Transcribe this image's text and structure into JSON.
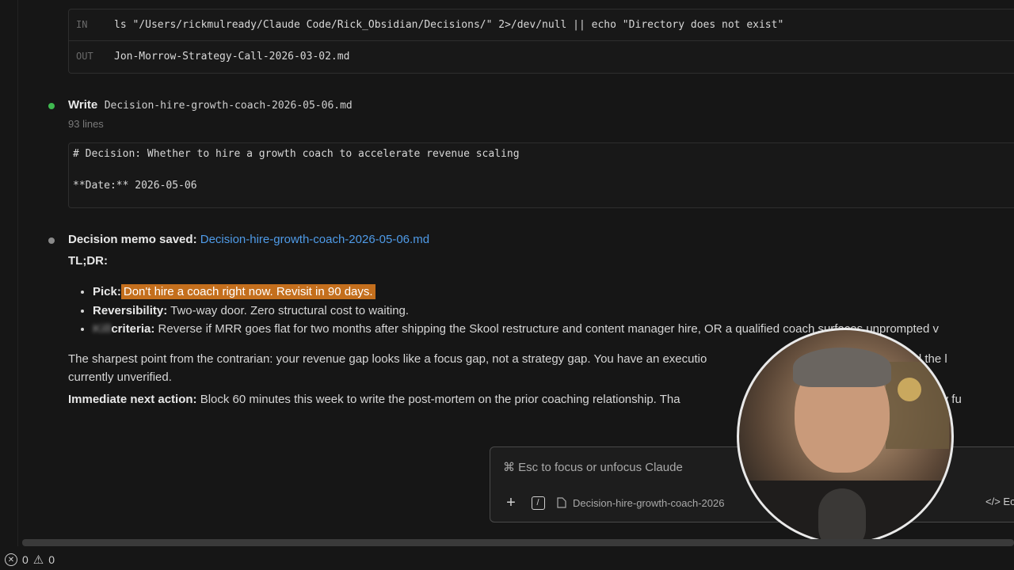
{
  "tool_block_1": {
    "in_tag": "IN",
    "in_text": "ls \"/Users/rickmulready/Claude Code/Rick_Obsidian/Decisions/\" 2>/dev/null || echo \"Directory does not exist\"",
    "out_tag": "OUT",
    "out_text": "Jon-Morrow-Strategy-Call-2026-03-02.md"
  },
  "write_step": {
    "action": "Write",
    "filename": "Decision-hire-growth-coach-2026-05-06.md",
    "line_count": "93 lines",
    "preview_line1": "# Decision: Whether to hire a growth coach to accelerate revenue scaling",
    "preview_line2": "**Date:** 2026-05-06"
  },
  "memo": {
    "saved_label": "Decision memo saved:",
    "saved_link": "Decision-hire-growth-coach-2026-05-06.md",
    "tldr": "TL;DR:",
    "bullets": [
      {
        "label": "Pick:",
        "text": "Don't hire a coach right now. Revisit in 90 days."
      },
      {
        "label": "Reversibility:",
        "text": " Two-way door. Zero structural cost to waiting."
      },
      {
        "label_blur": "Kill",
        "label": "criteria:",
        "text": " Reverse if MRR goes flat for two months after shipping the Skool restructure and content manager hire, OR a qualified coach surfaces unprompted v"
      }
    ],
    "para1_line1": "The sharpest point from the contrarian: your revenue gap looks like a focus gap, not a strategy gap. You have an executio",
    "para1_tail": "cuum. And the l",
    "para1_line2": "currently unverified.",
    "next_label": "Immediate next action:",
    "next_text": " Block 60 minutes this week to write the post-mortem on the prior coaching relationship. Tha",
    "next_tail": "efore any fu"
  },
  "prompt": {
    "placeholder": "⌘ Esc to focus or unfocus Claude",
    "attachment": "Decision-hire-growth-coach-2026",
    "edit_label": "</> Ec"
  },
  "status": {
    "errors": "0",
    "warnings": "0"
  },
  "colors": {
    "background": "#161616",
    "link": "#4f9be8",
    "highlight": "#c46f1d",
    "success_dot": "#3fb950"
  }
}
